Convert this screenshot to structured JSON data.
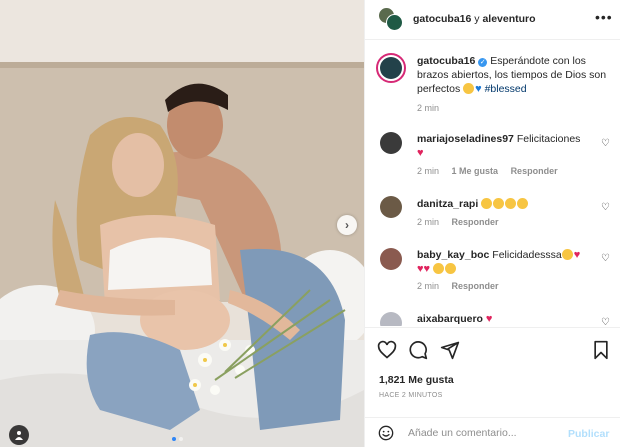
{
  "post": {
    "header": {
      "username": "gatocuba16",
      "connector": "y",
      "collaborator": "aleventuro"
    },
    "caption": {
      "username": "gatocuba16",
      "text": "Esperándote con los brazos abiertos, los tiempos de Dios son perfectos",
      "hashtag": "#blessed",
      "time": "2 min"
    },
    "comments": [
      {
        "username": "mariajoseladines97",
        "text": "Felicitaciones",
        "time": "2 min",
        "likes": "1 Me gusta",
        "reply": "Responder"
      },
      {
        "username": "danitza_rapi",
        "text": "",
        "time": "2 min",
        "likes": "",
        "reply": "Responder"
      },
      {
        "username": "baby_kay_boc",
        "text": "Felicidadesssa",
        "time": "2 min",
        "likes": "",
        "reply": "Responder"
      },
      {
        "username": "aixabarquero",
        "text": "",
        "time": "",
        "likes": "",
        "reply": ""
      }
    ],
    "likes": "1,821 Me gusta",
    "posted_ago": "HACE 2 MINUTOS",
    "comment_placeholder": "Añade un comentario...",
    "publish_label": "Publicar",
    "carousel": {
      "count": 2,
      "active": 0
    },
    "icons": {
      "more": "more-options-icon",
      "like": "heart-icon",
      "comment": "comment-icon",
      "share": "share-icon",
      "save": "bookmark-icon",
      "emoji": "emoji-icon",
      "next": "chevron-right-icon",
      "tags": "user-tag-icon"
    },
    "colors": {
      "accent": "#0095f6",
      "publish_disabled": "#b2dffc",
      "hashtag": "#00376b",
      "heart": "#ed4956",
      "muted": "#8e8e8e"
    }
  }
}
